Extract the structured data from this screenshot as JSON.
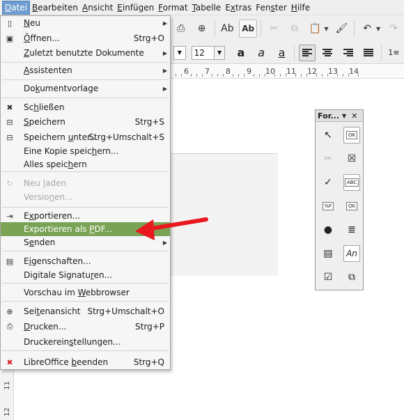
{
  "menubar": {
    "items": [
      "Datei",
      "Bearbeiten",
      "Ansicht",
      "Einfügen",
      "Format",
      "Tabelle",
      "Extras",
      "Fenster",
      "Hilfe"
    ],
    "mnemonics": [
      "D",
      "B",
      "A",
      "E",
      "F",
      "T",
      "x",
      "s",
      "H"
    ],
    "open_index": 0
  },
  "toolbar": {
    "spellcheck_label": "Ab",
    "autospell_label": "Ab",
    "font_size": "12",
    "bold_glyph": "a",
    "italic_glyph": "a",
    "underline_glyph": "a"
  },
  "ruler": {
    "numbers": [
      "6",
      "7",
      "8",
      "9",
      "10",
      "11",
      "12",
      "13",
      "14"
    ]
  },
  "vertical_ruler": {
    "numbers": [
      "11",
      "12"
    ]
  },
  "file_menu": {
    "items": [
      {
        "pre": "",
        "u": "N",
        "post": "eu",
        "shortcut": "",
        "submenu": true,
        "disabled": false,
        "icon": "new-doc-icon",
        "glyph": "▯"
      },
      {
        "pre": "",
        "u": "Ö",
        "post": "ffnen...",
        "shortcut": "Strg+O",
        "submenu": false,
        "disabled": false,
        "icon": "open-folder-icon",
        "glyph": "▣"
      },
      {
        "pre": "",
        "u": "Z",
        "post": "uletzt benutzte Dokumente",
        "shortcut": "",
        "submenu": true,
        "disabled": false,
        "icon": "",
        "glyph": ""
      },
      {
        "pre": "",
        "u": "A",
        "post": "ssistenten",
        "shortcut": "",
        "submenu": true,
        "disabled": false,
        "icon": "",
        "glyph": ""
      },
      {
        "pre": "Do",
        "u": "k",
        "post": "umentvorlage",
        "shortcut": "",
        "submenu": true,
        "disabled": false,
        "icon": "",
        "glyph": ""
      },
      {
        "pre": "Sc",
        "u": "h",
        "post": "ließen",
        "shortcut": "",
        "submenu": false,
        "disabled": false,
        "icon": "close-x-icon",
        "glyph": "✖"
      },
      {
        "pre": "",
        "u": "S",
        "post": "peichern",
        "shortcut": "Strg+S",
        "submenu": false,
        "disabled": false,
        "icon": "save-icon",
        "glyph": "⊟"
      },
      {
        "pre": "Speichern ",
        "u": "u",
        "post": "nter...",
        "shortcut": "Strg+Umschalt+S",
        "submenu": false,
        "disabled": false,
        "icon": "save-as-icon",
        "glyph": "⊟"
      },
      {
        "pre": "Eine Kopie speic",
        "u": "h",
        "post": "ern...",
        "shortcut": "",
        "submenu": false,
        "disabled": false,
        "icon": "",
        "glyph": ""
      },
      {
        "pre": "Alles speic",
        "u": "h",
        "post": "ern",
        "shortcut": "",
        "submenu": false,
        "disabled": false,
        "icon": "",
        "glyph": ""
      },
      {
        "pre": "Neu ",
        "u": "l",
        "post": "aden",
        "shortcut": "",
        "submenu": false,
        "disabled": true,
        "icon": "reload-icon",
        "glyph": "↻"
      },
      {
        "pre": "Versio",
        "u": "n",
        "post": "en...",
        "shortcut": "",
        "submenu": false,
        "disabled": true,
        "icon": "",
        "glyph": ""
      },
      {
        "pre": "E",
        "u": "x",
        "post": "portieren...",
        "shortcut": "",
        "submenu": false,
        "disabled": false,
        "icon": "export-icon",
        "glyph": "⇥"
      },
      {
        "pre": "Exportieren als ",
        "u": "P",
        "post": "DF...",
        "shortcut": "",
        "submenu": false,
        "disabled": false,
        "icon": "",
        "glyph": ""
      },
      {
        "pre": "S",
        "u": "e",
        "post": "nden",
        "shortcut": "",
        "submenu": true,
        "disabled": false,
        "icon": "",
        "glyph": ""
      },
      {
        "pre": "E",
        "u": "i",
        "post": "genschaften...",
        "shortcut": "",
        "submenu": false,
        "disabled": false,
        "icon": "properties-icon",
        "glyph": "▤"
      },
      {
        "pre": "Digitale Signatu",
        "u": "r",
        "post": "en...",
        "shortcut": "",
        "submenu": false,
        "disabled": false,
        "icon": "",
        "glyph": ""
      },
      {
        "pre": "Vorschau im ",
        "u": "W",
        "post": "ebbrowser",
        "shortcut": "",
        "submenu": false,
        "disabled": false,
        "icon": "",
        "glyph": ""
      },
      {
        "pre": "Sei",
        "u": "t",
        "post": "enansicht",
        "shortcut": "Strg+Umschalt+O",
        "submenu": false,
        "disabled": false,
        "icon": "page-preview-icon",
        "glyph": "⊕"
      },
      {
        "pre": "",
        "u": "D",
        "post": "rucken...",
        "shortcut": "Strg+P",
        "submenu": false,
        "disabled": false,
        "icon": "printer-icon",
        "glyph": "⎙"
      },
      {
        "pre": "Druckerein",
        "u": "s",
        "post": "tellungen...",
        "shortcut": "",
        "submenu": false,
        "disabled": false,
        "icon": "",
        "glyph": ""
      },
      {
        "pre": "LibreOffice ",
        "u": "b",
        "post": "eenden",
        "shortcut": "Strg+Q",
        "submenu": false,
        "disabled": false,
        "icon": "quit-x-icon",
        "glyph": "✖"
      }
    ],
    "highlighted_index": 13,
    "highlight_color": "#7aa356"
  },
  "form_panel": {
    "title": "For...",
    "close_glyph": "✕",
    "controls": [
      {
        "icon": "select-pointer-icon",
        "glyph": "↖",
        "boxed": false,
        "dim": false
      },
      {
        "icon": "push-button-icon",
        "glyph": "OK",
        "boxed": true,
        "dim": false
      },
      {
        "icon": "design-mode-icon",
        "glyph": "✂",
        "boxed": false,
        "dim": true
      },
      {
        "icon": "control-wizard-icon",
        "glyph": "☒",
        "boxed": false,
        "dim": false
      },
      {
        "icon": "checkbox-icon",
        "glyph": "✓",
        "boxed": false,
        "dim": false
      },
      {
        "icon": "text-box-icon",
        "glyph": "ABC",
        "boxed": true,
        "dim": false
      },
      {
        "icon": "formatted-field-icon",
        "glyph": "%F",
        "boxed": false,
        "dim": false
      },
      {
        "icon": "option-button-small-icon",
        "glyph": "OK",
        "boxed": false,
        "dim": false
      },
      {
        "icon": "option-button-icon",
        "glyph": "●",
        "boxed": false,
        "dim": false
      },
      {
        "icon": "list-box-icon",
        "glyph": "≣",
        "boxed": false,
        "dim": false
      },
      {
        "icon": "combo-box-icon",
        "glyph": "▤",
        "boxed": false,
        "dim": false
      },
      {
        "icon": "label-field-icon",
        "glyph": "An",
        "boxed": true,
        "dim": false
      },
      {
        "icon": "more-controls-icon",
        "glyph": "☑",
        "boxed": false,
        "dim": false
      },
      {
        "icon": "form-design-icon",
        "glyph": "⧉",
        "boxed": false,
        "dim": false
      }
    ]
  },
  "annotation": {
    "arrow_color": "#e8181e"
  }
}
